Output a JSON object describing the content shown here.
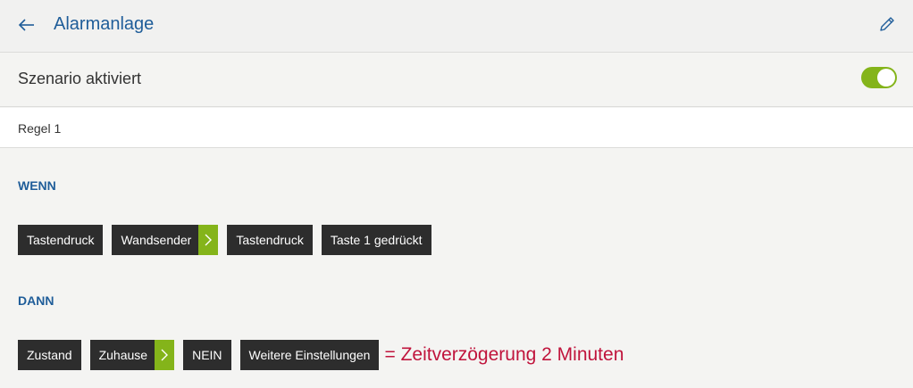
{
  "header": {
    "title": "Alarmanlage",
    "back_icon": "arrow-left-icon",
    "edit_icon": "pencil-icon"
  },
  "scenario": {
    "label": "Szenario aktiviert",
    "enabled": true
  },
  "rule": {
    "label": "Regel 1"
  },
  "when": {
    "label": "WENN",
    "chips": [
      {
        "label": "Tastendruck"
      },
      {
        "label": "Wandsender"
      },
      {
        "label": "Tastendruck"
      },
      {
        "label": "Taste 1 gedrückt"
      }
    ]
  },
  "then": {
    "label": "DANN",
    "chips": [
      {
        "label": "Zustand"
      },
      {
        "label": "Zuhause"
      },
      {
        "label": "NEIN"
      },
      {
        "label": "Weitere Einstellungen"
      }
    ],
    "annotation": "= Zeitverzögerung 2 Minuten"
  },
  "colors": {
    "accent_blue": "#1f5d99",
    "accent_green": "#84b41a",
    "chip_bg": "#2d2d2d",
    "annotation_red": "#c0143c"
  }
}
